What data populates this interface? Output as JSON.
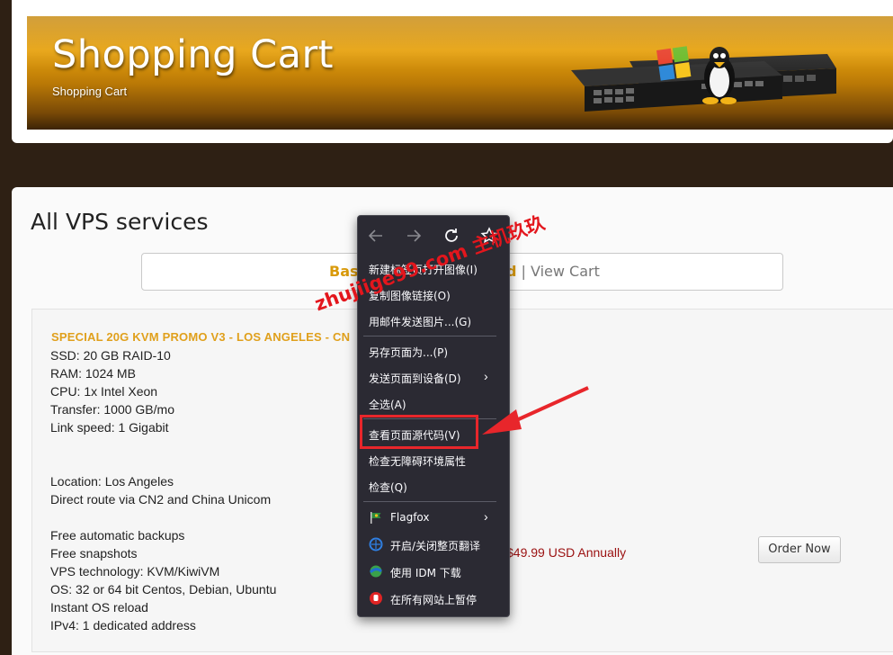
{
  "header": {
    "title": "Shopping Cart",
    "subtitle": "Shopping Cart"
  },
  "main": {
    "page_title": "All VPS services",
    "nav": {
      "basket_label": "Bas",
      "basket_tail": "d",
      "separator": "|",
      "view_cart_label": "View Cart"
    },
    "product": {
      "name": "SPECIAL 20G KVM PROMO V3 - LOS ANGELES - CN",
      "specs": [
        "SSD: 20 GB RAID-10",
        "RAM: 1024 MB",
        "CPU: 1x Intel Xeon",
        "Transfer: 1000 GB/mo",
        "Link speed: 1 Gigabit",
        "Location: Los Angeles",
        "Direct route via CN2 and China Unicom",
        "Free automatic backups",
        "Free snapshots",
        "VPS technology: KVM/KiwiVM",
        "OS: 32 or 64 bit Centos, Debian, Ubuntu",
        "Instant OS reload",
        "IPv4: 1 dedicated address"
      ],
      "price": "$49.99 USD Annually",
      "order_button": "Order Now"
    }
  },
  "context_menu": {
    "nav_icons": [
      "back-arrow-icon",
      "forward-arrow-icon",
      "reload-icon",
      "bookmark-star-icon"
    ],
    "items": [
      {
        "label": "新建标签页打开图像(I)"
      },
      {
        "label": "复制图像链接(O)"
      },
      {
        "label": "用邮件发送图片...(G)"
      },
      {
        "label": "另存页面为...(P)"
      },
      {
        "label": "发送页面到设备(D)",
        "submenu": true
      },
      {
        "label": "全选(A)"
      },
      {
        "label": "查看页面源代码(V)",
        "highlighted": true
      },
      {
        "label": "检查无障碍环境属性"
      },
      {
        "label": "检查(Q)"
      },
      {
        "label": "Flagfox",
        "icon": "flag-icon",
        "submenu": true
      },
      {
        "label": "开启/关闭整页翻译",
        "icon": "translate-icon"
      },
      {
        "label": "使用 IDM 下载",
        "icon": "idm-download-icon"
      },
      {
        "label": "在所有网站上暂停",
        "icon": "stop-hand-icon"
      }
    ]
  },
  "annotations": {
    "watermark": "zhujiige99.com 主机玖玖",
    "highlight_color": "#e8262b"
  },
  "colors": {
    "accent_gold": "#d99a0b",
    "price_red": "#9b1111",
    "menu_bg": "#2b2a33"
  }
}
